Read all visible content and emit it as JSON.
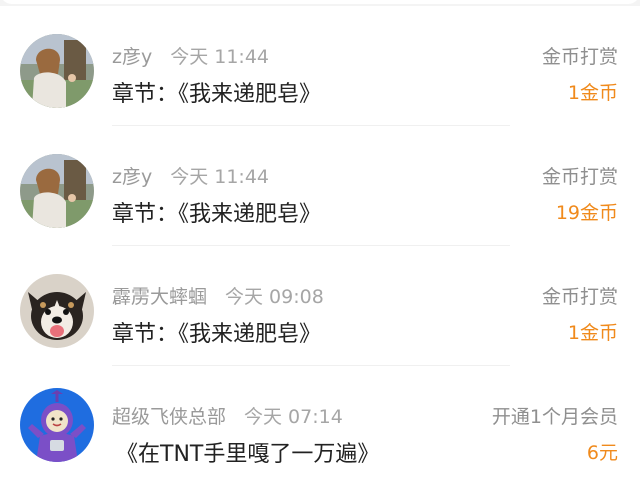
{
  "items": [
    {
      "username": "z彦y",
      "time": "今天 11:44",
      "content": "章节：《我来递肥皂》",
      "action": "金币打赏",
      "amount": "1金币",
      "avatar_icon": "girl-painting-avatar"
    },
    {
      "username": "z彦y",
      "time": "今天 11:44",
      "content": "章节：《我来递肥皂》",
      "action": "金币打赏",
      "amount": "19金币",
      "avatar_icon": "girl-painting-avatar"
    },
    {
      "username": "霹雳大蟀蝈",
      "time": "今天 09:08",
      "content": "章节：《我来递肥皂》",
      "action": "金币打赏",
      "amount": "1金币",
      "avatar_icon": "dog-avatar"
    },
    {
      "username": "超级飞侠总部",
      "time": "今天 07:14",
      "content": "《在TNT手里嘎了一万遍》",
      "action": "开通1个月会员",
      "amount": "6元",
      "avatar_icon": "teletubby-avatar"
    }
  ],
  "colors": {
    "amount": "#f08a1c",
    "background": "#f4f4f4",
    "card": "#ffffff"
  }
}
